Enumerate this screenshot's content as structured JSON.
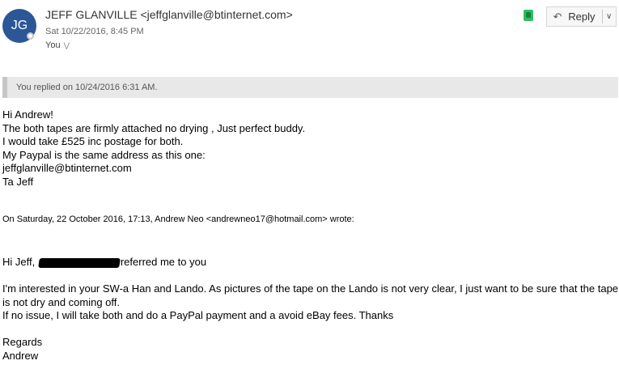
{
  "header": {
    "avatar_initials": "JG",
    "sender": "JEFF GLANVILLE <jeffglanville@btinternet.com>",
    "date": "Sat 10/22/2016, 8:45 PM",
    "to": "You",
    "reply_label": "Reply"
  },
  "notice": "You replied on 10/24/2016 6:31 AM.",
  "body_lines": [
    "Hi Andrew!",
    "The both tapes are firmly attached no drying , Just perfect buddy.",
    "I would take £525 inc postage for both.",
    "My Paypal is the same address as this one:",
    "jeffglanville@btinternet.com",
    "Ta Jeff"
  ],
  "quote_header": "On Saturday, 22 October 2016, 17:13, Andrew Neo <andrewneo17@hotmail.com> wrote:",
  "quoted": {
    "greeting_pre": "Hi Jeff,",
    "greeting_post": "referred me to you",
    "para": [
      "I'm interested in your SW-a Han and Lando. As pictures of the tape on the Lando is not very clear, I just want to be sure that the tape is not dry and coming off.",
      "If no issue, I will take both and do a PayPal payment and a avoid eBay fees. Thanks"
    ],
    "signoff": "Regards",
    "name": "Andrew"
  },
  "colors": {
    "avatar": "#2b5797",
    "evernote": "#2dbe60",
    "notice_bg": "#e8e8e8"
  },
  "icons": [
    "presence-icon",
    "evernote-icon",
    "reply-arrow-icon",
    "chevron-down-icon"
  ]
}
